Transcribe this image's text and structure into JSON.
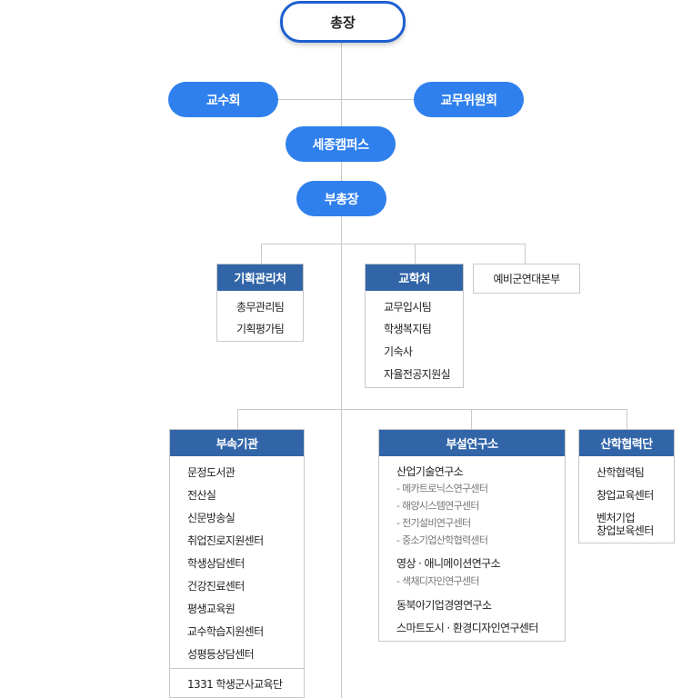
{
  "president": "총장",
  "faculty_council": "교수회",
  "academic_committee": "교무위원회",
  "sejong_campus": "세종캠퍼스",
  "vice_president": "부총장",
  "planning_office": {
    "title": "기획관리처",
    "items": [
      "총무관리팀",
      "기획평가팀"
    ]
  },
  "academic_affairs": {
    "title": "교학처",
    "items": [
      "교무입시팀",
      "학생복지팀",
      "기숙사",
      "자율전공지원실"
    ]
  },
  "reserve_hq": "예비군연대본부",
  "affiliated": {
    "title": "부속기관",
    "items": [
      "문정도서관",
      "전산실",
      "신문방송실",
      "취업진로지원센터",
      "학생상담센터",
      "건강진료센터",
      "평생교육원",
      "교수학습지원센터",
      "성평등상담센터"
    ],
    "extra": "1331 학생군사교육단"
  },
  "research": {
    "title": "부설연구소",
    "institute1": "산업기술연구소",
    "institute1_subs": [
      "- 메카트로닉스연구센터",
      "- 해양시스템연구센터",
      "- 전기설비연구센터",
      "- 중소기업산학협력센터"
    ],
    "institute2": "영상 · 애니메이션연구소",
    "institute2_subs": [
      "- 색채디자인연구센터"
    ],
    "institute3": "동북아기업경영연구소",
    "institute4": "스마트도시 · 환경디자인연구센터"
  },
  "industry": {
    "title": "산학협력단",
    "items": [
      "산학협력팀",
      "창업교육센터"
    ],
    "venture_line1": "벤처기업",
    "venture_line2": "창업보육센터"
  }
}
